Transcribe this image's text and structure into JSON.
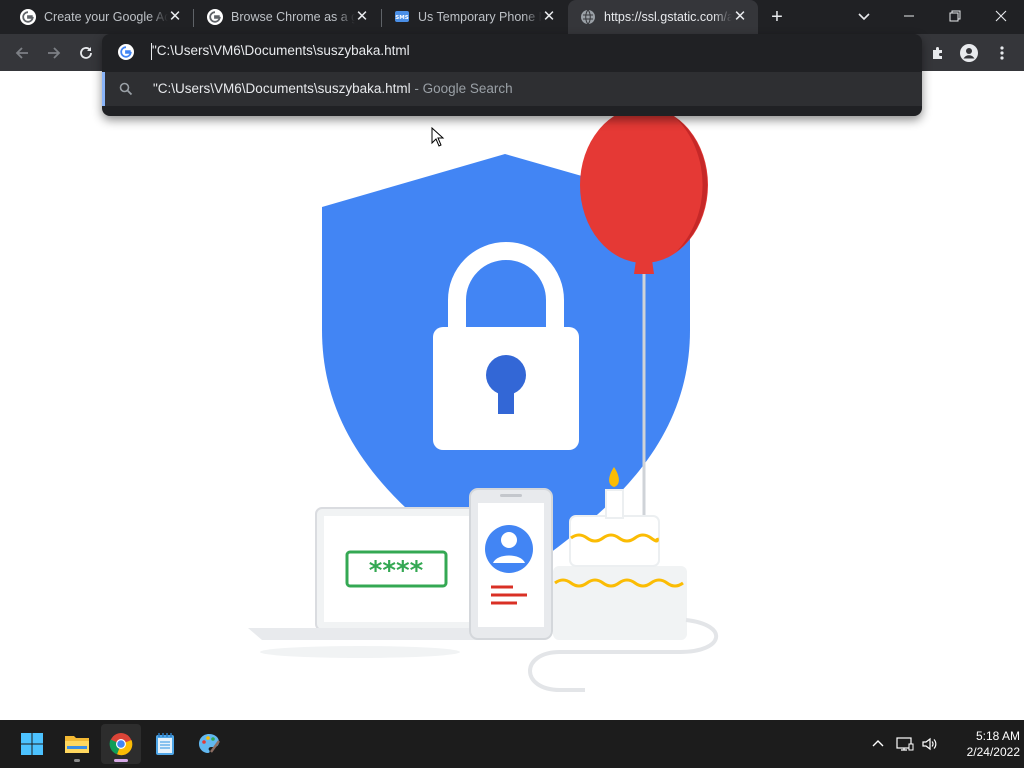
{
  "tabs": [
    {
      "title": "Create your Google Account",
      "favicon": "google-g-icon",
      "active": false
    },
    {
      "title": "Browse Chrome as a guest",
      "favicon": "google-g-icon",
      "active": false
    },
    {
      "title": "Us Temporary Phone Number",
      "favicon": "sms-icon",
      "active": false
    },
    {
      "title": "https://ssl.gstatic.com/accounts",
      "favicon": "globe-icon",
      "active": true
    }
  ],
  "omnibox": {
    "typed_text": "\"C:\\Users\\VM6\\Documents\\suszybaka.html",
    "suggestion": {
      "query": "\"C:\\Users\\VM6\\Documents\\suszybaka.html",
      "separator": " - ",
      "engine": "Google Search"
    }
  },
  "illustration": {
    "password_mask": "****"
  },
  "taskbar": {
    "apps": [
      "start-icon",
      "file-explorer-icon",
      "chrome-icon",
      "notepad-icon",
      "paint-icon"
    ],
    "time": "5:18 AM",
    "date": "2/24/2022"
  },
  "colors": {
    "tab_strip_bg": "#202124",
    "toolbar_bg": "#35363a",
    "shield_blue": "#4285f4",
    "balloon_red": "#e53935",
    "taskbar_bg": "#1c1c1c"
  }
}
